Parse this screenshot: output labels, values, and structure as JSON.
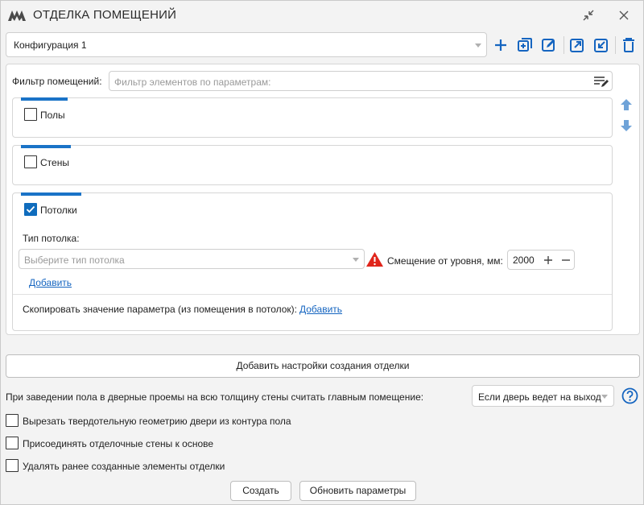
{
  "window": {
    "title": "ОТДЕЛКА ПОМЕЩЕНИЙ"
  },
  "config": {
    "value": "Конфигурация 1"
  },
  "toolbar": {
    "icons": [
      "add-icon",
      "copy-add-icon",
      "edit-icon",
      "export-icon",
      "import-icon",
      "delete-icon"
    ]
  },
  "filter": {
    "label": "Фильтр помещений:",
    "placeholder": "Фильтр элементов по параметрам:"
  },
  "sections": {
    "floors": {
      "label": "Полы",
      "checked": false
    },
    "walls": {
      "label": "Стены",
      "checked": false
    },
    "ceilings": {
      "label": "Потолки",
      "checked": true,
      "type_label": "Тип потолка:",
      "type_placeholder": "Выберите тип потолка",
      "offset_label": "Смещение от уровня, мм:",
      "offset_value": "2000",
      "add_link": "Добавить",
      "copy_param_label": "Скопировать значение параметра (из помещения в потолок):",
      "copy_param_link": "Добавить"
    }
  },
  "add_settings_button": "Добавить настройки создания отделки",
  "door_rule": {
    "label": "При заведении пола в дверные проемы на всю толщину стены считать главным помещение:",
    "value": "Если дверь ведет на выход"
  },
  "options": {
    "cut_geometry": "Вырезать твердотельную геометрию двери из контура пола",
    "join_walls": "Присоединять отделочные стены к основе",
    "delete_old": "Удалять ранее созданные элементы отделки"
  },
  "buttons": {
    "create": "Создать",
    "update_params": "Обновить параметры"
  },
  "colors": {
    "accent": "#1a73c7",
    "warning": "#e0251b",
    "checked": "#0f6cbd"
  }
}
